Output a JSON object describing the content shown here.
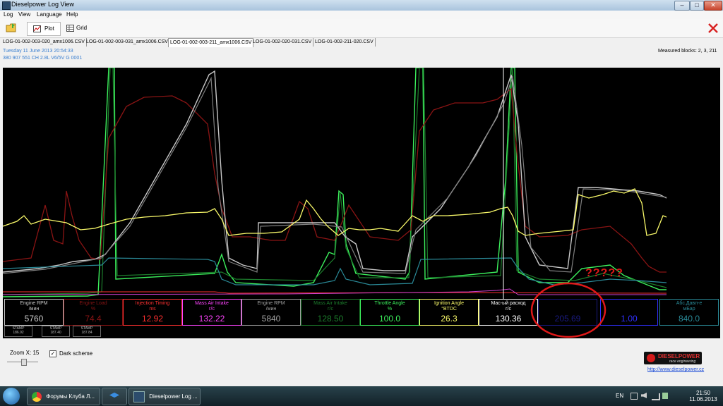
{
  "window": {
    "title": "Dieselpower Log View",
    "minimize": "–",
    "maximize": "□",
    "close": "✕"
  },
  "menu": [
    "Log",
    "View",
    "Language",
    "Help"
  ],
  "toolbar": {
    "plot_label": "Plot",
    "grid_label": "Grid",
    "open_icon": "folder-open-icon",
    "close_icon": "red-x-icon"
  },
  "tabs": [
    {
      "label": "LOG-01-002-003-020_amx1006.CSV",
      "active": false
    },
    {
      "label": "LOG-01-002-003-031_amx1006.CSV",
      "active": false
    },
    {
      "label": "LOG-01-002-003-211_amx1006.CSV",
      "active": true
    },
    {
      "label": "LOG-01-002-020-031.CSV",
      "active": false
    },
    {
      "label": "LOG-01-002-211-020.CSV",
      "active": false
    }
  ],
  "info": {
    "date": "Tuesday 11 June 2013 20:54:33",
    "ecu": "380 907 551 CH  2.8L V6/5V     G   0001"
  },
  "measured": "Measured blocks: 2, 3, 211",
  "channels": [
    {
      "name": "Engine RPM",
      "unit": "/мин",
      "value": "5760",
      "color": "#c8c8c8"
    },
    {
      "name": "Engine Load",
      "unit": "%",
      "value": "74.4",
      "color": "#8a1414"
    },
    {
      "name": "Injection Timing",
      "unit": "ms",
      "value": "12.92",
      "color": "#ff3030"
    },
    {
      "name": "Mass Air Intake",
      "unit": "г/с",
      "value": "132.22",
      "color": "#ff44ff"
    },
    {
      "name": "Engine RPM",
      "unit": "/мин",
      "value": "5840",
      "color": "#a0a0a0"
    },
    {
      "name": "Mass Air Intake",
      "unit": "г/с",
      "value": "128.50",
      "color": "#1c7d2c"
    },
    {
      "name": "Throttle Angle",
      "unit": "%",
      "value": "100.0",
      "color": "#3cf05c"
    },
    {
      "name": "Ignition Angle",
      "unit": "°BTDC",
      "value": "26.3",
      "color": "#fafa6a"
    },
    {
      "name": "Мас-ый расход",
      "unit": "г/с",
      "value": "130.36",
      "color": "#ffffff"
    },
    {
      "name": "",
      "unit": "",
      "value": "205.69",
      "color": "#1a1a80"
    },
    {
      "name": "",
      "unit": "",
      "value": "1.00",
      "color": "#3030ff"
    },
    {
      "name": "Абс.Давл-е",
      "unit": "мБар",
      "value": "840.0",
      "color": "#2a8a98"
    }
  ],
  "stamps": [
    {
      "label": "STAMP",
      "value": "186.92"
    },
    {
      "label": "STAMP",
      "value": "187.40"
    },
    {
      "label": "STAMP",
      "value": "187.84"
    }
  ],
  "annotation": "?????",
  "zoom": {
    "label": "Zoom X: 15",
    "value": 15
  },
  "dark_scheme": {
    "label": "Dark scheme",
    "checked": true
  },
  "brand": {
    "name": "DIESELPOWER",
    "tagline": "race engineering",
    "url": "http://www.dieselpower.cz"
  },
  "taskbar": {
    "items": [
      {
        "label": "Форумы Клуба Л..."
      },
      {
        "label": "Dieselpower Log ..."
      }
    ],
    "lang": "EN",
    "time": "21:50",
    "date": "11.06.2013"
  }
}
